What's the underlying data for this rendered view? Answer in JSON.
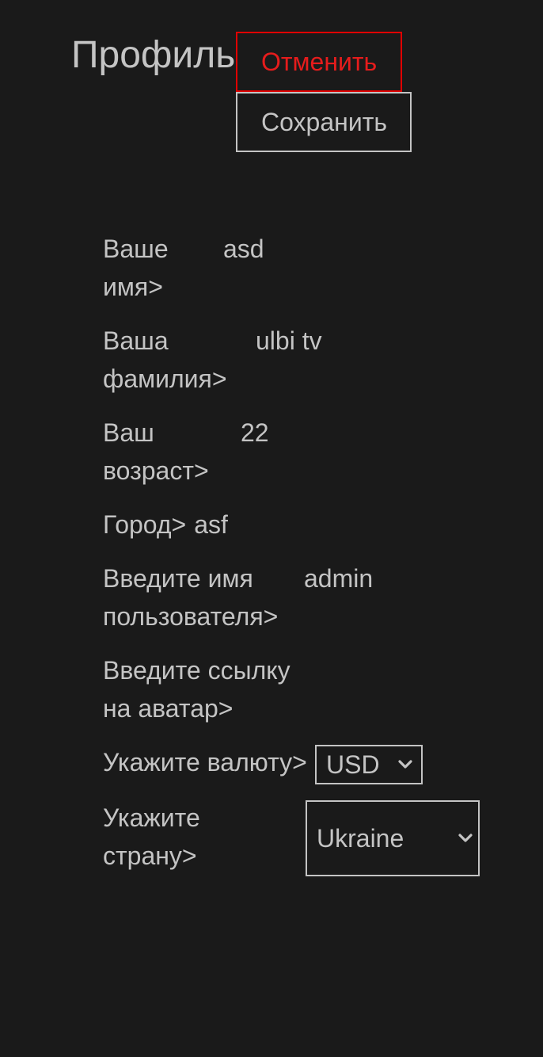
{
  "header": {
    "title": "Профиль",
    "cancel_label": "Отменить",
    "save_label": "Сохранить"
  },
  "form": {
    "first_name": {
      "label_line1": "Ваше",
      "label_line2": "имя>",
      "value": "asd"
    },
    "last_name": {
      "label_line1": "Ваша",
      "label_line2": "фамилия>",
      "value": "ulbi tv"
    },
    "age": {
      "label_line1": "Ваш",
      "label_line2": "возраст>",
      "value": "22"
    },
    "city": {
      "label": "Город>",
      "value": "asf"
    },
    "username": {
      "label_line1": "Введите имя",
      "label_line2": "пользователя>",
      "value": "admin"
    },
    "avatar": {
      "label_line1": "Введите ссылку",
      "label_line2": "на аватар>",
      "value": ""
    },
    "currency": {
      "label": "Укажите валюту>",
      "selected": "USD"
    },
    "country": {
      "label_line1": "Укажите",
      "label_line2": "страну>",
      "selected": "Ukraine"
    }
  },
  "colors": {
    "background": "#1a1a1a",
    "text": "#c4c4c4",
    "danger": "#e00000"
  }
}
